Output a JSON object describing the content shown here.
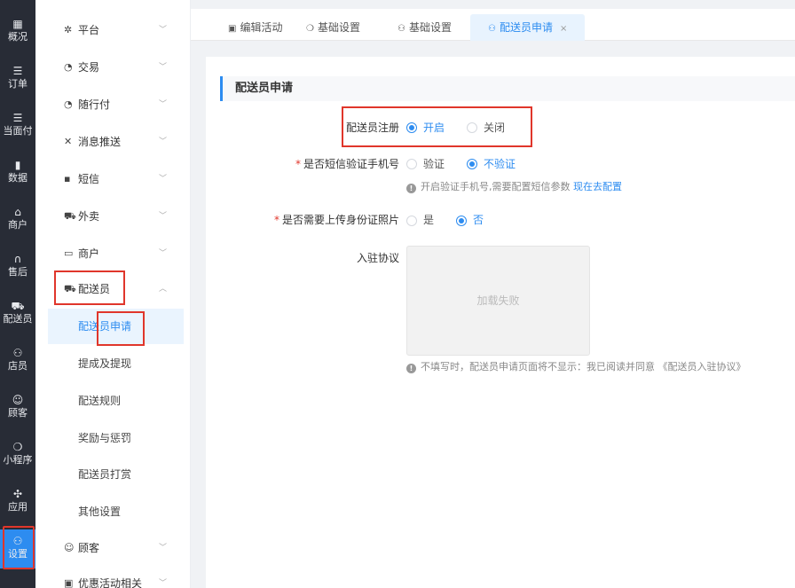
{
  "rail": {
    "items": [
      {
        "icon": "▦",
        "label": "概况"
      },
      {
        "icon": "☰",
        "label": "订单"
      },
      {
        "icon": "☰",
        "label": "当面付"
      },
      {
        "icon": "▮",
        "label": "数据"
      },
      {
        "icon": "⌂",
        "label": "商户"
      },
      {
        "icon": "∩",
        "label": "售后"
      },
      {
        "icon": "⛟",
        "label": "配送员"
      },
      {
        "icon": "⚇",
        "label": "店员"
      },
      {
        "icon": "☺",
        "label": "顾客"
      },
      {
        "icon": "❍",
        "label": "小程序"
      },
      {
        "icon": "✣",
        "label": "应用"
      },
      {
        "icon": "⚇",
        "label": "设置"
      }
    ]
  },
  "sidebar": {
    "groups": [
      {
        "icon": "✲",
        "label": "平台"
      },
      {
        "icon": "◔",
        "label": "交易"
      },
      {
        "icon": "◔",
        "label": "随行付"
      },
      {
        "icon": "✕",
        "label": "消息推送"
      },
      {
        "icon": "▪",
        "label": "短信"
      },
      {
        "icon": "⛟",
        "label": "外卖"
      },
      {
        "icon": "▭",
        "label": "商户"
      },
      {
        "icon": "⛟",
        "label": "配送员"
      }
    ],
    "courier_sub": [
      "配送员申请",
      "提成及提现",
      "配送规则",
      "奖励与惩罚",
      "配送员打赏",
      "其他设置"
    ],
    "bottom_groups": [
      {
        "icon": "☺",
        "label": "顾客"
      },
      {
        "icon": "▣",
        "label": "优惠活动相关"
      }
    ]
  },
  "tabs": [
    {
      "icon": "▣",
      "label": "编辑活动"
    },
    {
      "icon": "❍",
      "label": "基础设置"
    },
    {
      "icon": "⚇",
      "label": "基础设置"
    },
    {
      "icon": "⚇",
      "label": "配送员申请",
      "close": "×"
    }
  ],
  "section": {
    "title": "配送员申请"
  },
  "form": {
    "registration": {
      "label": "配送员注册",
      "on_label": "开启",
      "off_label": "关闭",
      "selected": "开启"
    },
    "sms_verify": {
      "required": "*",
      "label": "是否短信验证手机号",
      "yes_label": "验证",
      "no_label": "不验证",
      "selected": "不验证",
      "hint_icon": "!",
      "hint": "开启验证手机号,需要配置短信参数",
      "hint_link": "现在去配置"
    },
    "id_photo": {
      "required": "*",
      "label": "是否需要上传身份证照片",
      "yes_label": "是",
      "no_label": "否",
      "selected": "否"
    },
    "agreement": {
      "label": "入驻协议",
      "image_text": "加载失败",
      "hint_icon": "!",
      "hint": "不填写时，配送员申请页面将不显示：我已阅读并同意 《配送员入驻协议》"
    }
  },
  "colors": {
    "accent": "#2d8cf0",
    "rail_bg": "#282c36",
    "highlight": "#e0362b"
  }
}
